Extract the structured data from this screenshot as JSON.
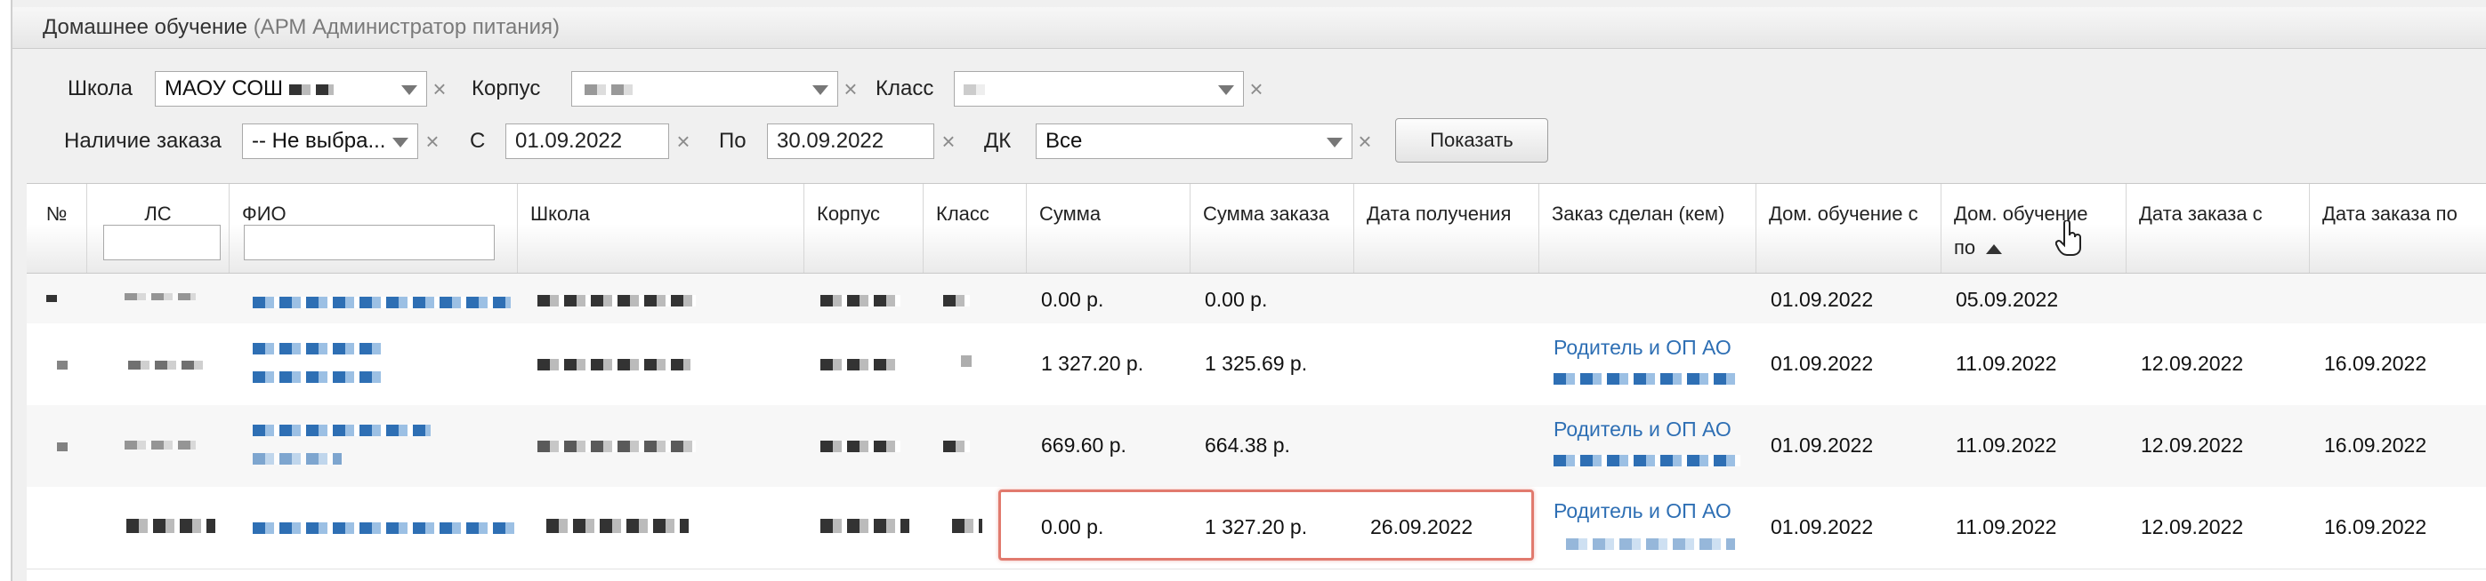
{
  "window": {
    "title": "Домашнее обучение",
    "subtitle": "(АРМ Администратор питания)"
  },
  "filters": {
    "school_label": "Школа",
    "school_value": "МАОУ СОШ",
    "building_label": "Корпус",
    "building_value": "",
    "class_label": "Класс",
    "class_value": "",
    "order_label": "Наличие заказа",
    "order_value": "-- Не выбра...",
    "from_label": "С",
    "from_value": "01.09.2022",
    "to_label": "По",
    "to_value": "30.09.2022",
    "dk_label": "ДК",
    "dk_value": "Все",
    "clear_glyph": "×",
    "show_button": "Показать"
  },
  "columns": {
    "num": "№",
    "ls": "ЛС",
    "fio": "ФИО",
    "school": "Школа",
    "building": "Корпус",
    "class": "Класс",
    "sum": "Сумма",
    "order_sum": "Сумма заказа",
    "received": "Дата получения",
    "made_by": "Заказ сделан (кем)",
    "home_from": "Дом. обучение с",
    "home_to_line1": "Дом. обучение",
    "home_to_line2": "по",
    "order_from": "Дата заказа с",
    "order_to": "Дата заказа по"
  },
  "rows": [
    {
      "sum": "0.00 р.",
      "order_sum": "0.00 р.",
      "received": "",
      "made_by": "",
      "home_from": "01.09.2022",
      "home_to": "05.09.2022",
      "order_from": "",
      "order_to": ""
    },
    {
      "sum": "1 327.20 р.",
      "order_sum": "1 325.69 р.",
      "received": "",
      "made_by": "Родитель и ОП АО",
      "home_from": "01.09.2022",
      "home_to": "11.09.2022",
      "order_from": "12.09.2022",
      "order_to": "16.09.2022"
    },
    {
      "sum": "669.60 р.",
      "order_sum": "664.38 р.",
      "received": "",
      "made_by": "Родитель и ОП АО",
      "home_from": "01.09.2022",
      "home_to": "11.09.2022",
      "order_from": "12.09.2022",
      "order_to": "16.09.2022"
    },
    {
      "sum": "0.00 р.",
      "order_sum": "1 327.20 р.",
      "received": "26.09.2022",
      "made_by": "Родитель и ОП АО",
      "home_from": "01.09.2022",
      "home_to": "11.09.2022",
      "order_from": "12.09.2022",
      "order_to": "16.09.2022"
    }
  ]
}
